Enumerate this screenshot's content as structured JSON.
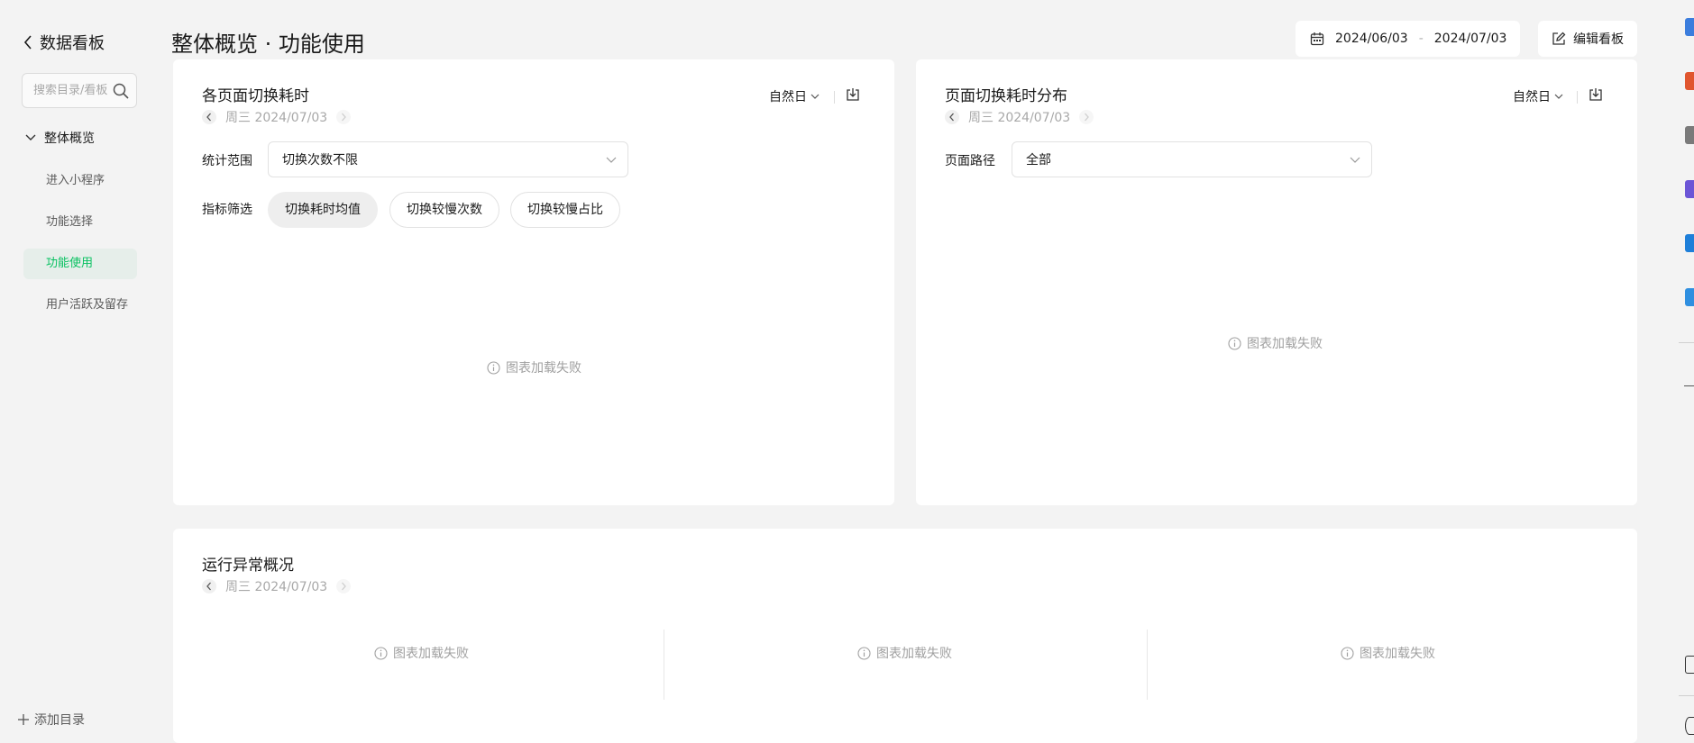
{
  "sidebar": {
    "back_label": "数据看板",
    "search_placeholder": "搜索目录/看板",
    "group_label": "整体概览",
    "items": [
      {
        "label": "进入小程序"
      },
      {
        "label": "功能选择"
      },
      {
        "label": "功能使用"
      },
      {
        "label": "用户活跃及留存"
      }
    ],
    "add_dir_label": "添加目录"
  },
  "header": {
    "title": "整体概览 · 功能使用",
    "date_start": "2024/06/03",
    "date_sep": "-",
    "date_end": "2024/07/03",
    "edit_label": "编辑看板"
  },
  "card_switch_time": {
    "title": "各页面切换耗时",
    "date_label": "周三 2024/07/03",
    "granularity": "自然日",
    "range_label": "统计范围",
    "range_value": "切换次数不限",
    "metric_label": "指标筛选",
    "metrics": [
      "切换耗时均值",
      "切换较慢次数",
      "切换较慢占比"
    ],
    "active_metric": "切换耗时均值",
    "fail_text": "图表加载失败"
  },
  "card_distribution": {
    "title": "页面切换耗时分布",
    "date_label": "周三 2024/07/03",
    "granularity": "自然日",
    "path_label": "页面路径",
    "path_value": "全部",
    "fail_text": "图表加载失败"
  },
  "card_exceptions": {
    "title": "运行异常概况",
    "date_label": "周三 2024/07/03",
    "fail_texts": [
      "图表加载失败",
      "图表加载失败",
      "图表加载失败"
    ]
  },
  "colors": {
    "accent": "#07c160",
    "active_bg": "#e6eeea",
    "page_bg": "#f3f3f3",
    "muted": "#a0a0a0"
  }
}
